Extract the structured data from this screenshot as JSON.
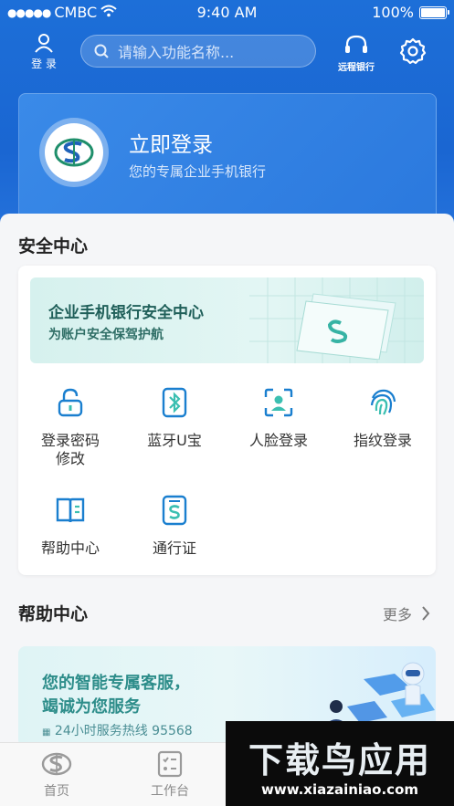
{
  "status_bar": {
    "carrier": "CMBC",
    "time": "9:40 AM",
    "battery": "100%"
  },
  "header": {
    "login_label": "登 录",
    "search_placeholder": "请输入功能名称...",
    "remote_bank_label": "远程银行"
  },
  "banner": {
    "title": "立即登录",
    "subtitle": "您的专属企业手机银行"
  },
  "security": {
    "section_title": "安全中心",
    "promo_title": "企业手机银行安全中心",
    "promo_subtitle": "为账户安全保驾护航",
    "items": [
      {
        "label": "登录密码修改",
        "icon": "lock-icon"
      },
      {
        "label": "蓝牙U宝",
        "icon": "bluetooth-icon"
      },
      {
        "label": "人脸登录",
        "icon": "face-scan-icon"
      },
      {
        "label": "指纹登录",
        "icon": "fingerprint-icon"
      },
      {
        "label": "帮助中心",
        "icon": "book-icon"
      },
      {
        "label": "通行证",
        "icon": "pass-card-icon"
      }
    ]
  },
  "help": {
    "section_title": "帮助中心",
    "more_label": "更多",
    "card_line1": "您的智能专属客服，",
    "card_line2": "竭诚为您服务",
    "hotline": "24小时服务热线 95568"
  },
  "tabbar": {
    "tabs": [
      {
        "label": "首页",
        "icon": "home-logo-icon"
      },
      {
        "label": "工作台",
        "icon": "workbench-icon"
      }
    ]
  },
  "watermark": {
    "title": "下载鸟应用",
    "url": "www.xiazainiao.com"
  },
  "colors": {
    "brand_blue": "#1d6fd8",
    "accent_teal": "#2d8d8a",
    "icon_blue": "#1a7fcf"
  }
}
